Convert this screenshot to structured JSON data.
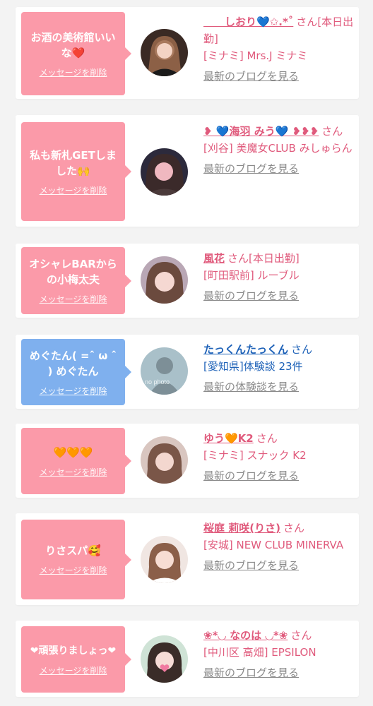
{
  "colors": {
    "pink_bubble": "#fb9aa9",
    "blue_bubble": "#7fb0ee",
    "name_pink": "#e05a7c",
    "name_blue": "#1e62b8",
    "link_gray": "#8a8a8a"
  },
  "delete_label": "メッセージを削除",
  "san_label": "さん",
  "items": [
    {
      "message": "お酒の美術館いいな❤️",
      "name": "　　しおり💙✩.*˚",
      "extra": "[本日出勤]",
      "shop": "[ミナミ] Mrs.J ミナミ",
      "link": "最新のブログを見る",
      "avatar_icon": "woman-photo-icon"
    },
    {
      "message": "私も新札GETしました🙌",
      "name": "❥ 💙海羽 みう💙 ❥❥❥",
      "extra": "",
      "shop": "[刈谷] 美魔女CLUB みしゅらん",
      "link": "最新のブログを見る",
      "avatar_icon": "woman-photo-icon"
    },
    {
      "message": "オシャレBARからの小梅太夫",
      "name": "風花",
      "extra": "[本日出勤]",
      "shop": "[町田駅前] ルーブル",
      "link": "最新のブログを見る",
      "avatar_icon": "woman-photo-icon"
    },
    {
      "message": "めぐたん( =ˆ ω ˆ ) めぐたん",
      "name": "たっくんたっくん",
      "extra": "",
      "shop": "[愛知県]体験談 23件",
      "link": "最新の体験談を見る",
      "avatar_icon": "no-photo-silhouette-icon",
      "avatar_text": "no photo"
    },
    {
      "message": "🧡🧡🧡",
      "name": "ゆう🧡K2",
      "extra": "",
      "shop": "[ミナミ] スナック K2",
      "link": "最新のブログを見る",
      "avatar_icon": "woman-photo-icon"
    },
    {
      "message": "りさスパ🥰",
      "name": "桜庭 莉咲(りさ)",
      "extra": "",
      "shop": "[安城] NEW CLUB MINERVA",
      "link": "最新のブログを見る",
      "avatar_icon": "woman-photo-icon"
    },
    {
      "message": "❤頑張りましょっ❤",
      "name": "❀*◡ なのは ◡*❀",
      "extra": "",
      "shop": "[中川区 高畑] EPSILON",
      "link": "最新のブログを見る",
      "avatar_icon": "woman-photo-icon"
    }
  ]
}
